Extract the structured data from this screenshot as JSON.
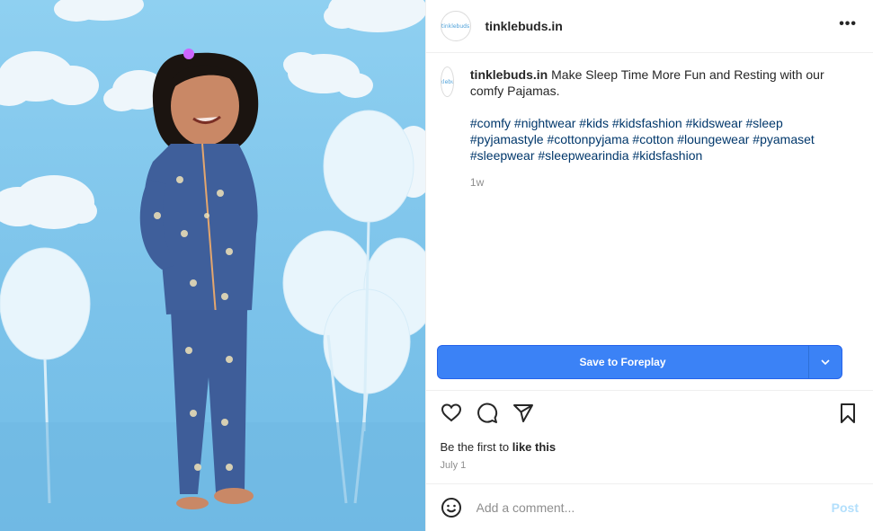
{
  "post": {
    "username": "tinklebuds.in",
    "avatar_text": "tinklebuds",
    "more_icon": "more-horizontal-icon",
    "caption_username": "tinklebuds.in",
    "caption_text": "Make Sleep Time More Fun and Resting with our comfy Pajamas.",
    "hashtags": "#comfy #nightwear #kids #kidsfashion #kidswear #sleep #pyjamastyle #cottonpyjama #cotton #loungewear #pyamaset #sleepwear #sleepwearindia #kidsfashion",
    "caption_age": "1w"
  },
  "save_button": {
    "label": "Save to Foreplay",
    "dropdown_icon": "chevron-down-icon"
  },
  "actions": {
    "icons": [
      "heart-icon",
      "comment-icon",
      "share-icon",
      "bookmark-icon"
    ]
  },
  "likes": {
    "prefix": "Be the first to ",
    "link": "like this"
  },
  "date": "July 1",
  "comment_box": {
    "placeholder": "Add a comment...",
    "post_label": "Post",
    "emoji_icon": "emoji-icon"
  },
  "colors": {
    "accent": "#3b82f6",
    "hashtag": "#00376b",
    "muted": "#8e8e8e",
    "post_disabled": "#b2dffc"
  }
}
